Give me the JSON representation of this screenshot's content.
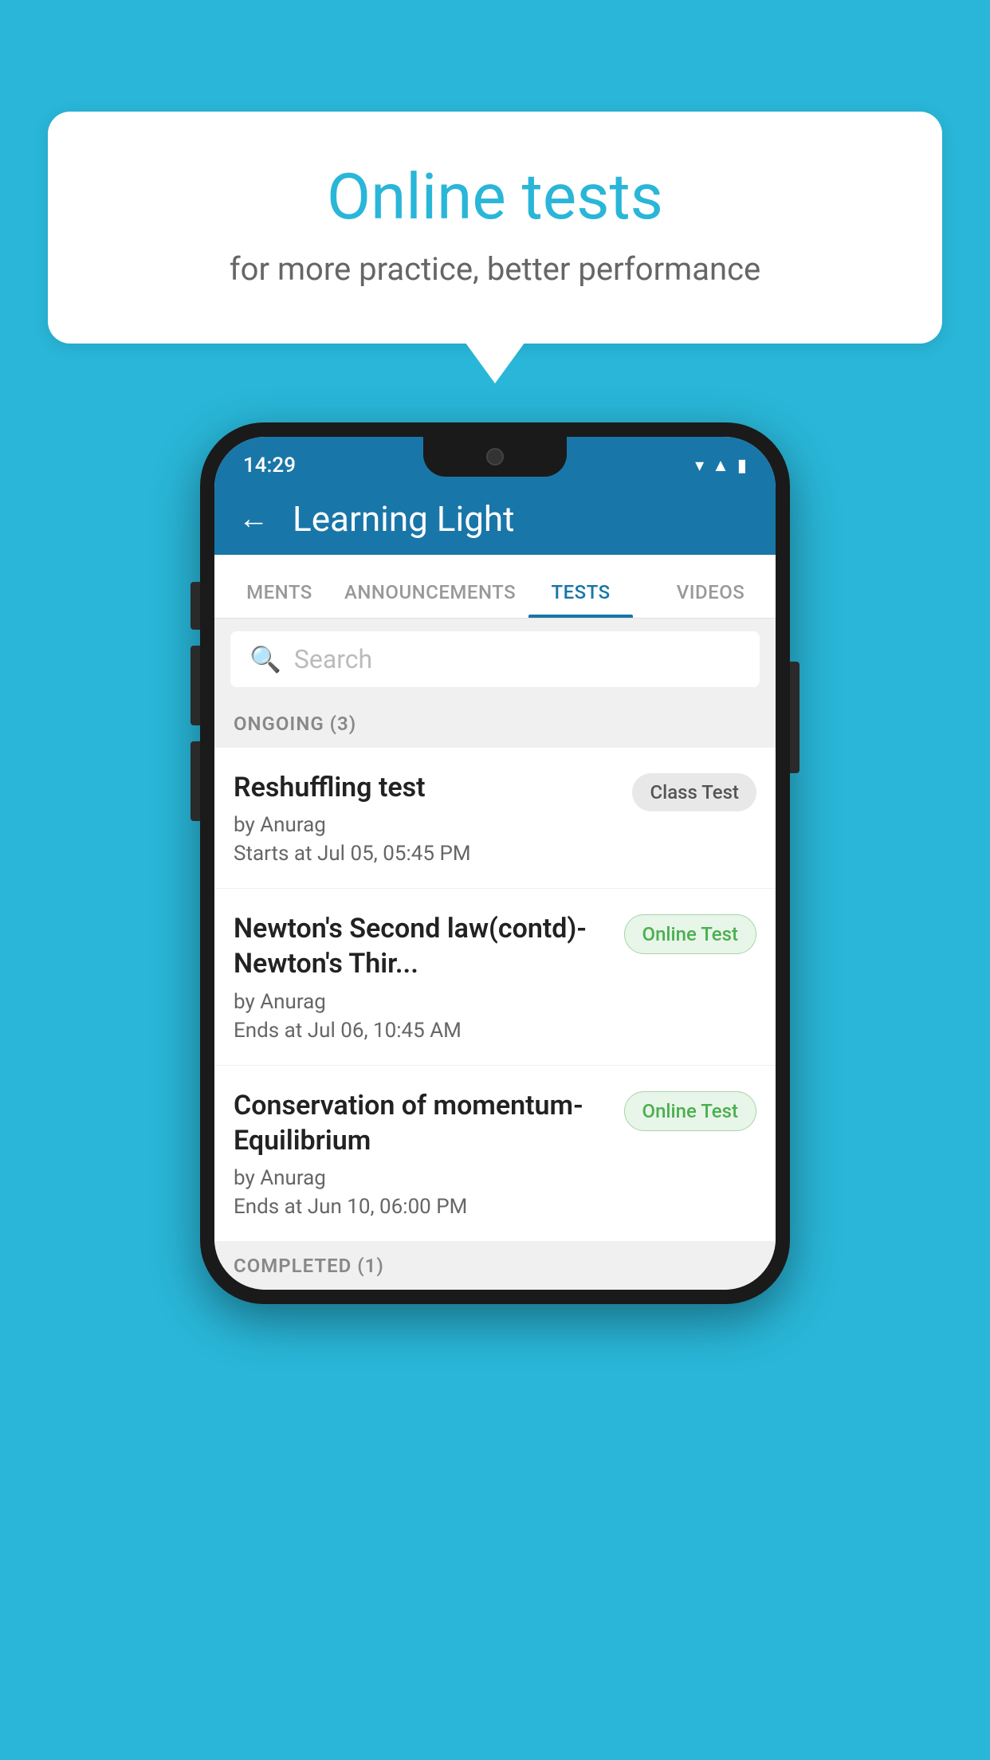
{
  "background": {
    "color": "#29b6d8"
  },
  "speechBubble": {
    "title": "Online tests",
    "subtitle": "for more practice, better performance"
  },
  "phone": {
    "statusBar": {
      "time": "14:29",
      "icons": [
        "wifi",
        "signal",
        "battery"
      ]
    },
    "header": {
      "backLabel": "←",
      "title": "Learning Light"
    },
    "tabs": [
      {
        "label": "MENTS",
        "active": false
      },
      {
        "label": "ANNOUNCEMENTS",
        "active": false
      },
      {
        "label": "TESTS",
        "active": true
      },
      {
        "label": "VIDEOS",
        "active": false
      }
    ],
    "search": {
      "placeholder": "Search"
    },
    "sections": [
      {
        "label": "ONGOING (3)",
        "tests": [
          {
            "name": "Reshuffling test",
            "author": "by Anurag",
            "date": "Starts at  Jul 05, 05:45 PM",
            "badgeType": "class",
            "badgeLabel": "Class Test"
          },
          {
            "name": "Newton's Second law(contd)-Newton's Thir...",
            "author": "by Anurag",
            "date": "Ends at  Jul 06, 10:45 AM",
            "badgeType": "online",
            "badgeLabel": "Online Test"
          },
          {
            "name": "Conservation of momentum-Equilibrium",
            "author": "by Anurag",
            "date": "Ends at  Jun 10, 06:00 PM",
            "badgeType": "online",
            "badgeLabel": "Online Test"
          }
        ]
      }
    ],
    "completedSection": {
      "label": "COMPLETED (1)"
    }
  }
}
